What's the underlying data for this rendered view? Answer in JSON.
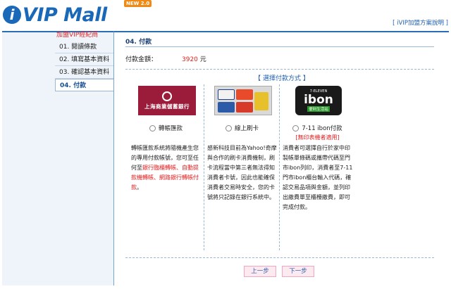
{
  "header": {
    "logo_i": "i",
    "logo_text": "VIP Mall",
    "logo_badge": "NEW 2.0",
    "link": "[ iVIP加盟方案說明 ]"
  },
  "sidebar": {
    "title": "加盟VIP經紀商",
    "items": [
      {
        "label": "01. 閱讀條款"
      },
      {
        "label": "02. 填寫基本資料"
      },
      {
        "label": "03. 確認基本資料"
      },
      {
        "label": "04. 付款"
      }
    ],
    "active_index": 3
  },
  "main": {
    "section_title": "04. 付款",
    "amount_label": "付款金額：",
    "amount_value": "3920",
    "amount_unit": "元",
    "payment_heading": "【 選擇付款方式 】",
    "options": [
      {
        "label": "轉帳匯款",
        "logo_text": "上海商業儲蓄銀行",
        "desc_parts": [
          {
            "text": "轉帳匯款系統將隨機產生您的專用付款帳號，您可至任何至",
            "red": false
          },
          {
            "text": "銀行臨櫃轉帳、自動提款機轉帳、網路銀行轉帳付款",
            "red": true
          },
          {
            "text": "。",
            "red": false
          }
        ]
      },
      {
        "label": "線上刷卡",
        "logo_text": "VISA MasterCard JCB",
        "desc_parts": [
          {
            "text": "感新科技目前為Yahoo!奇摩與合作的刷卡消費機制，刷卡流程當中第三者無法得知消費者卡號，因此也能確保消費者交易時安全，您的卡號將只記錄在銀行系統中。",
            "red": false
          }
        ]
      },
      {
        "label": "7-11 ibon付款",
        "logo_small": "7-ELEVEN",
        "logo_big": "ibon",
        "logo_tag": "便利生活站",
        "note": "[無印表機者適用]",
        "desc_parts": [
          {
            "text": "消費者可選擇自行於家中印製帳單條碼或攜帶代碼至門市ibon列印，消費者至7-11門市ibon櫃台輸入代碼，確認交易品項與金額，並列印出繳費單至櫃檯繳費，即可完成付款。",
            "red": false
          }
        ]
      }
    ],
    "prev_label": "上一步",
    "next_label": "下一步"
  },
  "colors": {
    "brand_blue": "#1a68b8",
    "accent_red": "#e02020",
    "badge_orange": "#f08a16"
  }
}
